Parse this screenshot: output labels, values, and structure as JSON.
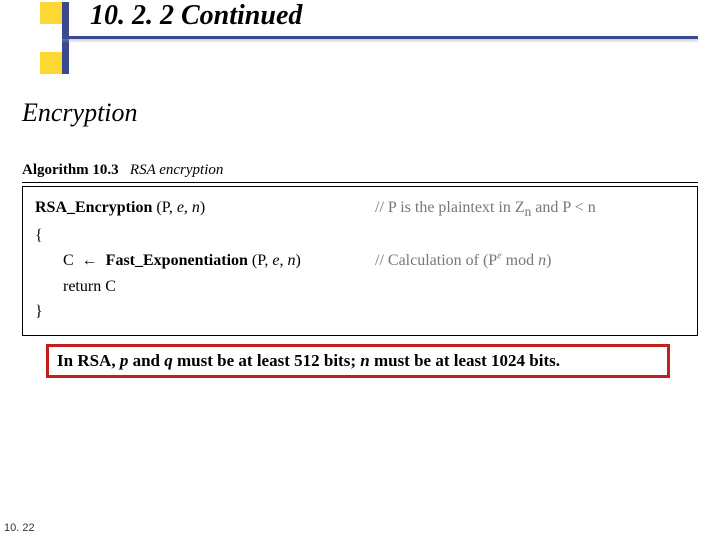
{
  "header": {
    "title": "10. 2. 2  Continued"
  },
  "section": {
    "heading": "Encryption"
  },
  "algorithm": {
    "label": "Algorithm 10.3",
    "caption": "RSA encryption",
    "fn_name": "RSA_Encryption",
    "fn_params": "(P, e, n)",
    "fn_comment_prefix": "// P is the plaintext in Z",
    "fn_comment_sub": "n",
    "fn_comment_suffix": " and P < n",
    "brace_open": "{",
    "line1_var": "C",
    "line1_arrow": "←",
    "line1_call": "Fast_Exponentiation",
    "line1_args": "(P, e, n)",
    "line1_comment_prefix": "// Calculation of (P",
    "line1_comment_sup": "e",
    "line1_comment_mid": " mod ",
    "line1_comment_n": "n",
    "line1_comment_suffix": ")",
    "line2": "return C",
    "brace_close": "}"
  },
  "note": {
    "prefix": "In RSA, ",
    "p": "p",
    "mid1": " and ",
    "q": "q",
    "mid2": " must be at least 512 bits; ",
    "n": "n",
    "suffix": " must be at least 1024 bits."
  },
  "page": {
    "number": "10. 22"
  }
}
